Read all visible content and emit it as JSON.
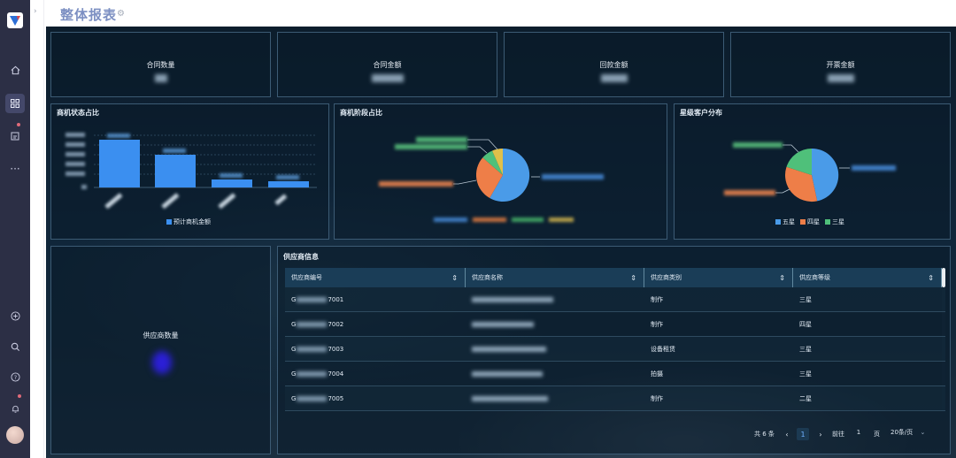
{
  "header": {
    "title": "整体报表",
    "settings_icon": "gear-icon"
  },
  "rail": {
    "items": [
      {
        "icon": "home-icon",
        "active": false
      },
      {
        "icon": "dashboard-grid-icon",
        "active": true
      },
      {
        "icon": "edit-doc-icon",
        "active": false
      },
      {
        "icon": "more-icon",
        "active": false
      }
    ],
    "bottom": [
      "add-circle-icon",
      "search-icon",
      "help-icon",
      "bell-icon"
    ]
  },
  "kpis": [
    {
      "label": "合同数量",
      "value": ""
    },
    {
      "label": "合同金额",
      "value": ""
    },
    {
      "label": "回款金额",
      "value": ""
    },
    {
      "label": "开票金额",
      "value": ""
    }
  ],
  "bar_panel": {
    "title": "商机状态占比",
    "legend": "预计商机金额",
    "color": "#3b8ff0"
  },
  "stage_panel": {
    "title": "商机阶段占比"
  },
  "star_panel": {
    "title": "星级客户分布",
    "legend": [
      {
        "name": "五星",
        "color": "#4a9be8"
      },
      {
        "name": "四星",
        "color": "#ee7e48"
      },
      {
        "name": "三星",
        "color": "#4fc07a"
      }
    ]
  },
  "supplier_count": {
    "title": "供应商数量"
  },
  "supplier_table": {
    "title": "供应商信息",
    "columns": [
      "供应商编号",
      "供应商名称",
      "供应商类别",
      "供应商等级"
    ],
    "rows": [
      {
        "code_prefix": "G",
        "code_suffix": "7001",
        "category": "制作",
        "level": "三星"
      },
      {
        "code_prefix": "G",
        "code_suffix": "7002",
        "category": "制作",
        "level": "四星"
      },
      {
        "code_prefix": "G",
        "code_suffix": "7003",
        "category": "设备租赁",
        "level": "三星"
      },
      {
        "code_prefix": "G",
        "code_suffix": "7004",
        "category": "拍摄",
        "level": "三星"
      },
      {
        "code_prefix": "G",
        "code_suffix": "7005",
        "category": "制作",
        "level": "二星"
      }
    ],
    "pagination": {
      "total": "共 6 条",
      "current_page": "1",
      "goto_label": "前往",
      "goto_value": "1",
      "page_unit": "页",
      "page_size": "20条/页"
    }
  }
}
